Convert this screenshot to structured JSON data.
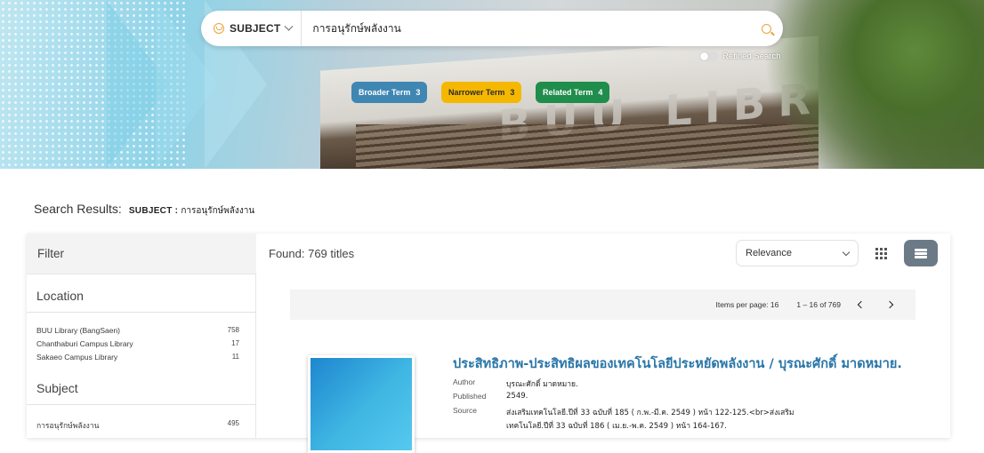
{
  "search": {
    "field_label": "SUBJECT",
    "query": "การอนุรักษ์พลังงาน",
    "refined_label": "Refined Search"
  },
  "hero": {
    "sign_text": "BUU LIBRARY"
  },
  "terms": {
    "broader": {
      "label": "Broader Term",
      "count": "3"
    },
    "narrower": {
      "label": "Narrower Term",
      "count": "3"
    },
    "related": {
      "label": "Related Term",
      "count": "4"
    }
  },
  "results": {
    "label": "Search Results:",
    "subject_prefix": "SUBJECT :",
    "subject_query": "การอนุรักษ์พลังงาน",
    "found": "Found: 769 titles"
  },
  "filter": {
    "title": "Filter",
    "location": {
      "title": "Location",
      "items": [
        {
          "label": "BUU Library (BangSaen)",
          "count": "758"
        },
        {
          "label": "Chanthaburi Campus Library",
          "count": "17"
        },
        {
          "label": "Sakaeo Campus Library",
          "count": "11"
        }
      ]
    },
    "subject": {
      "title": "Subject",
      "items": [
        {
          "label": "การอนุรักษ์พลังงาน",
          "count": "495"
        }
      ]
    }
  },
  "toolbar": {
    "sort_label": "Relevance"
  },
  "pager": {
    "items_per_page": "Items per page: 16",
    "range": "1 – 16 of 769"
  },
  "record": {
    "title": "ประสิทธิภาพ-ประสิทธิผลของเทคโนโลยีประหยัดพลังงาน / บุรณะศักดิ์ มาดหมาย.",
    "author_label": "Author",
    "author": "บุรณะศักดิ์ มาดหมาย.",
    "published_label": "Published",
    "published": "2549.",
    "source_label": "Source",
    "source": "ส่งเสริมเทคโนโลยี.ปีที่ 33 ฉบับที่ 185 ( ก.พ.-มี.ค. 2549 ) หน้า 122-125.<br>ส่งเสริม",
    "source_cont": "เทคโนโลยี.ปีที่ 33 ฉบับที่ 186 ( เม.ย.-พ.ค. 2549 ) หน้า 164-167."
  },
  "colors": {
    "broader": "#3f86b3",
    "narrower": "#f5b800",
    "related": "#1f8d4b",
    "accent": "#e9a33b",
    "title_link": "#2a76a8"
  },
  "icons": [
    "subject-icon",
    "chevron-down-icon",
    "search-icon",
    "grid-view-icon",
    "list-view-icon",
    "chevron-left-icon",
    "chevron-right-icon"
  ]
}
